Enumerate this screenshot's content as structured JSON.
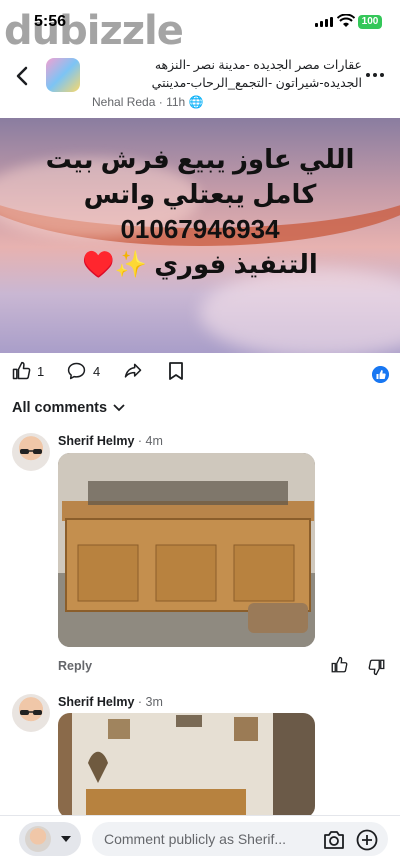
{
  "status_bar": {
    "time": "5:56",
    "battery": "100"
  },
  "watermark": "dubizzle",
  "header": {
    "group_title_line1": "عقارات مصر الجديده -مدينة نصر -النزهه",
    "group_title_line2": "الجديده-شيراتون -التجمع_الرحاب-مدينتي",
    "author": "Nehal Reda",
    "time": "11h"
  },
  "post": {
    "line1": "اللي عاوز يبيع فرش بيت",
    "line2": "كامل يبعتلي واتس",
    "line3": "01067946934",
    "line4": "التنفيذ فوري ✨♥️"
  },
  "actions": {
    "likes": "1",
    "comments": "4"
  },
  "comments_header": "All comments",
  "comments": [
    {
      "author": "Sherif Helmy",
      "time": "4m",
      "reply": "Reply"
    },
    {
      "author": "Sherif Helmy",
      "time": "3m"
    }
  ],
  "composer": {
    "placeholder": "Comment publicly as Sherif..."
  },
  "colors": {
    "accent": "#1877f2",
    "battery": "#34c759"
  }
}
